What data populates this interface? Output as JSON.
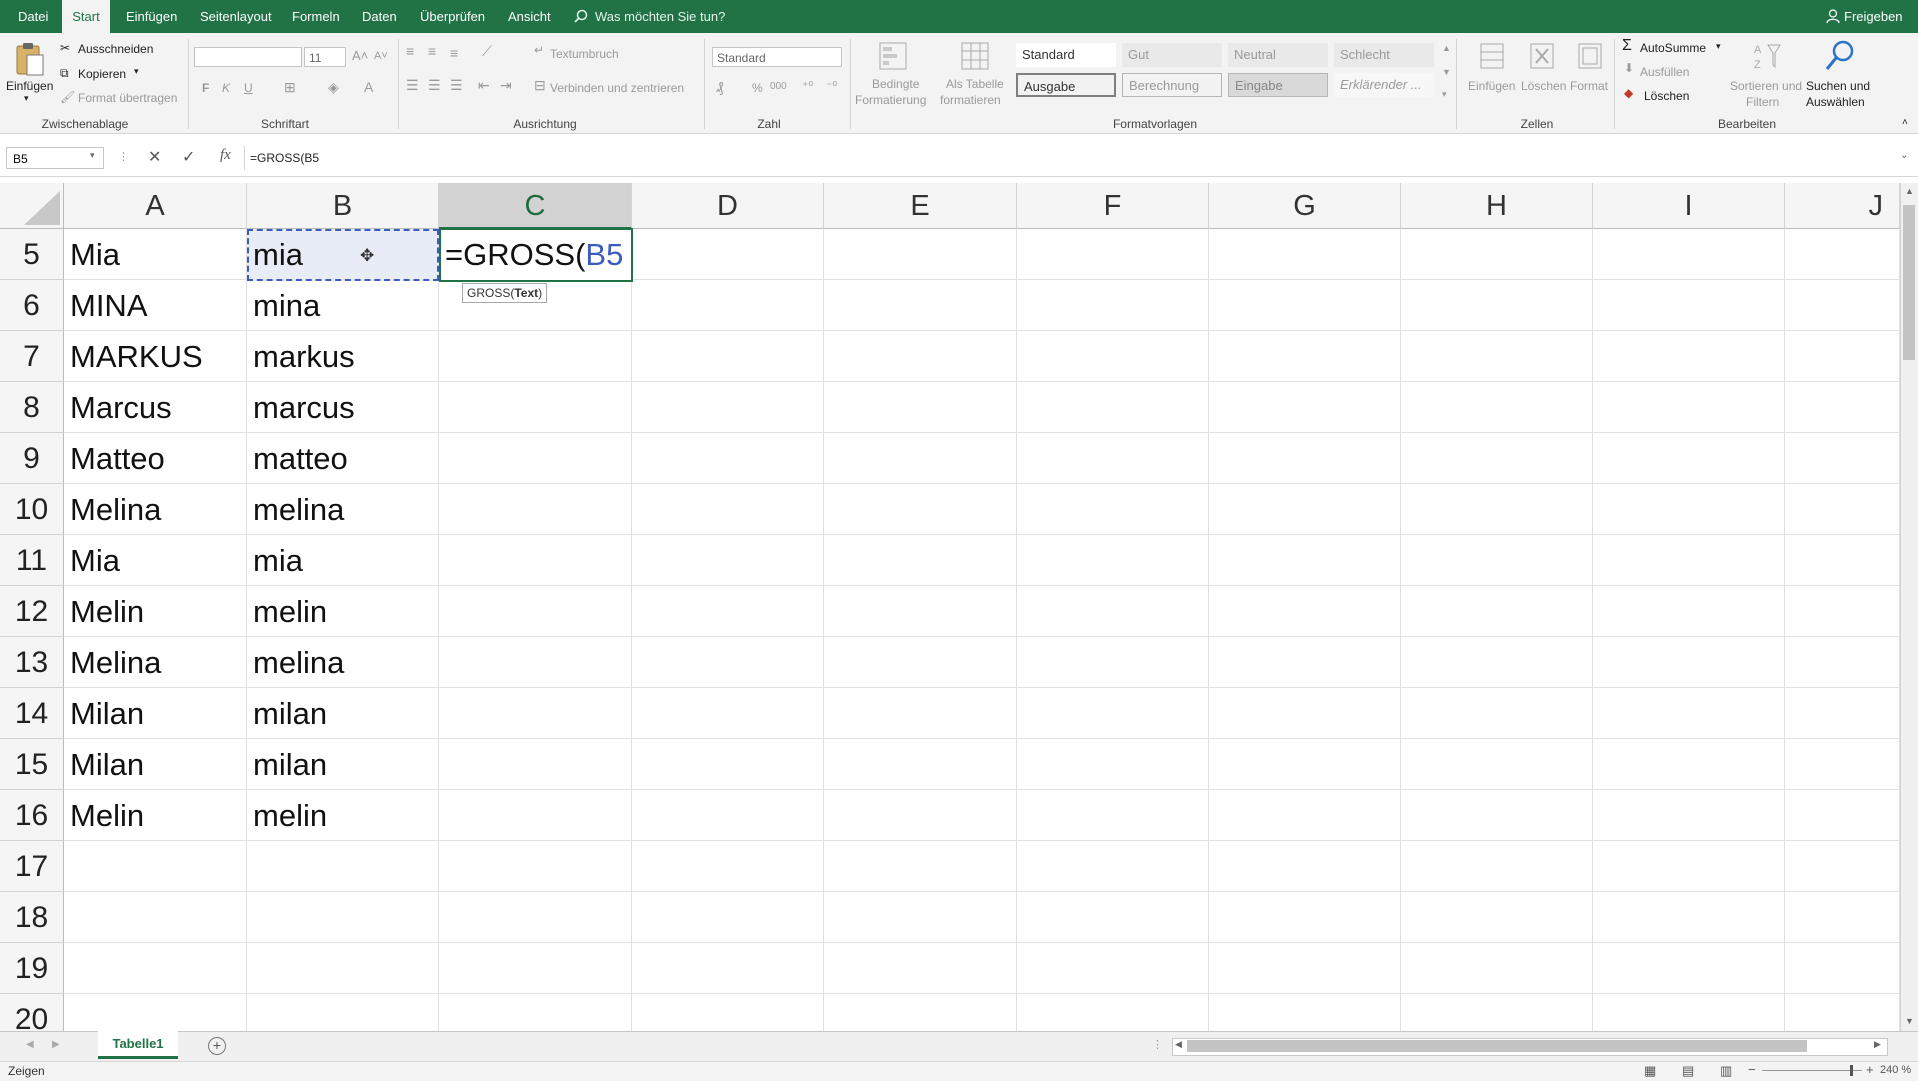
{
  "menu": {
    "items": [
      "Datei",
      "Start",
      "Einfügen",
      "Seitenlayout",
      "Formeln",
      "Daten",
      "Überprüfen",
      "Ansicht"
    ],
    "active": "Start",
    "tell_me": "Was möchten Sie tun?",
    "share": "Freigeben"
  },
  "ribbon": {
    "clipboard": {
      "paste": "Einfügen",
      "cut": "Ausschneiden",
      "copy": "Kopieren",
      "format_painter": "Format übertragen",
      "label": "Zwischenablage"
    },
    "font": {
      "name": "",
      "size": "11",
      "bold": "F",
      "italic": "K",
      "underline": "U",
      "label": "Schriftart"
    },
    "alignment": {
      "wrap": "Textumbruch",
      "merge": "Verbinden und zentrieren",
      "label": "Ausrichtung"
    },
    "number": {
      "format": "Standard",
      "percent": "%",
      "thousands": "000",
      "label": "Zahl"
    },
    "styles": {
      "conditional_line1": "Bedingte",
      "conditional_line2": "Formatierung",
      "as_table_line1": "Als Tabelle",
      "as_table_line2": "formatieren",
      "boxes": [
        "Standard",
        "Gut",
        "Neutral",
        "Schlecht",
        "Ausgabe",
        "Berechnung",
        "Eingabe",
        "Erklärender ..."
      ],
      "label": "Formatvorlagen"
    },
    "cells": {
      "insert": "Einfügen",
      "delete": "Löschen",
      "format": "Format",
      "label": "Zellen"
    },
    "editing": {
      "autosum": "AutoSumme",
      "fill": "Ausfüllen",
      "clear": "Löschen",
      "sort_line1": "Sortieren und",
      "sort_line2": "Filtern",
      "find_line1": "Suchen und",
      "find_line2": "Auswählen",
      "label": "Bearbeiten"
    }
  },
  "formula_bar": {
    "name_box": "B5",
    "formula": "=GROSS(B5"
  },
  "grid": {
    "columns": [
      "A",
      "B",
      "C",
      "D",
      "E",
      "F",
      "G",
      "H",
      "I",
      "J"
    ],
    "selected_column": "C",
    "rows": [
      {
        "num": "5",
        "a": "Mia",
        "b": "mia"
      },
      {
        "num": "6",
        "a": "MINA",
        "b": "mina"
      },
      {
        "num": "7",
        "a": "MARKUS",
        "b": "markus"
      },
      {
        "num": "8",
        "a": "Marcus",
        "b": "marcus"
      },
      {
        "num": "9",
        "a": "Matteo",
        "b": "matteo"
      },
      {
        "num": "10",
        "a": "Melina",
        "b": "melina"
      },
      {
        "num": "11",
        "a": "Mia",
        "b": "mia"
      },
      {
        "num": "12",
        "a": "Melin",
        "b": "melin"
      },
      {
        "num": "13",
        "a": "Melina",
        "b": "melina"
      },
      {
        "num": "14",
        "a": "Milan",
        "b": "milan"
      },
      {
        "num": "15",
        "a": "Milan",
        "b": "milan"
      },
      {
        "num": "16",
        "a": "Melin",
        "b": "melin"
      },
      {
        "num": "17",
        "a": "",
        "b": ""
      },
      {
        "num": "18",
        "a": "",
        "b": ""
      },
      {
        "num": "19",
        "a": "",
        "b": ""
      },
      {
        "num": "20",
        "a": "",
        "b": ""
      }
    ],
    "edit_cell_prefix": "=GROSS(",
    "edit_cell_ref": "B5",
    "tooltip_fn": "GROSS(",
    "tooltip_arg": "Text",
    "tooltip_close": ")"
  },
  "sheet_tabs": {
    "active": "Tabelle1",
    "add": "+"
  },
  "status": {
    "mode": "Zeigen",
    "zoom": "240 %"
  },
  "colors": {
    "brand": "#217346",
    "ref_blue": "#3c5bbf"
  }
}
